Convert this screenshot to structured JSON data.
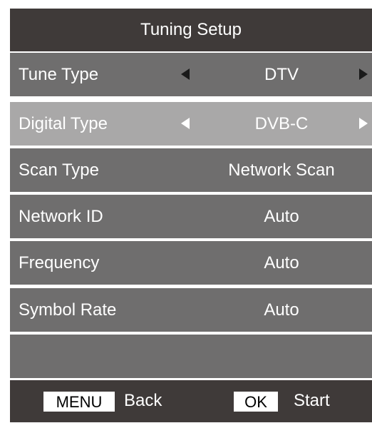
{
  "title": "Tuning Setup",
  "rows": [
    {
      "label": "Tune Type",
      "value": "DTV",
      "arrows": true
    },
    {
      "label": "Digital Type",
      "value": "DVB-C",
      "arrows": true,
      "selected": true
    },
    {
      "label": "Scan Type",
      "value": "Network Scan"
    },
    {
      "label": "Network ID",
      "value": "Auto"
    },
    {
      "label": "Frequency",
      "value": "Auto"
    },
    {
      "label": "Symbol Rate",
      "value": "Auto"
    }
  ],
  "footer": {
    "menu_key": "MENU",
    "back_label": "Back",
    "ok_key": "OK",
    "start_label": "Start"
  },
  "colors": {
    "header_footer_bg": "#3f3a39",
    "row_bg": "#6f6e6e",
    "selected_row_bg": "#a9a8a8",
    "text": "#ffffff"
  },
  "icons": {
    "left_arrow": "triangle-left-icon",
    "right_arrow": "triangle-right-icon"
  }
}
